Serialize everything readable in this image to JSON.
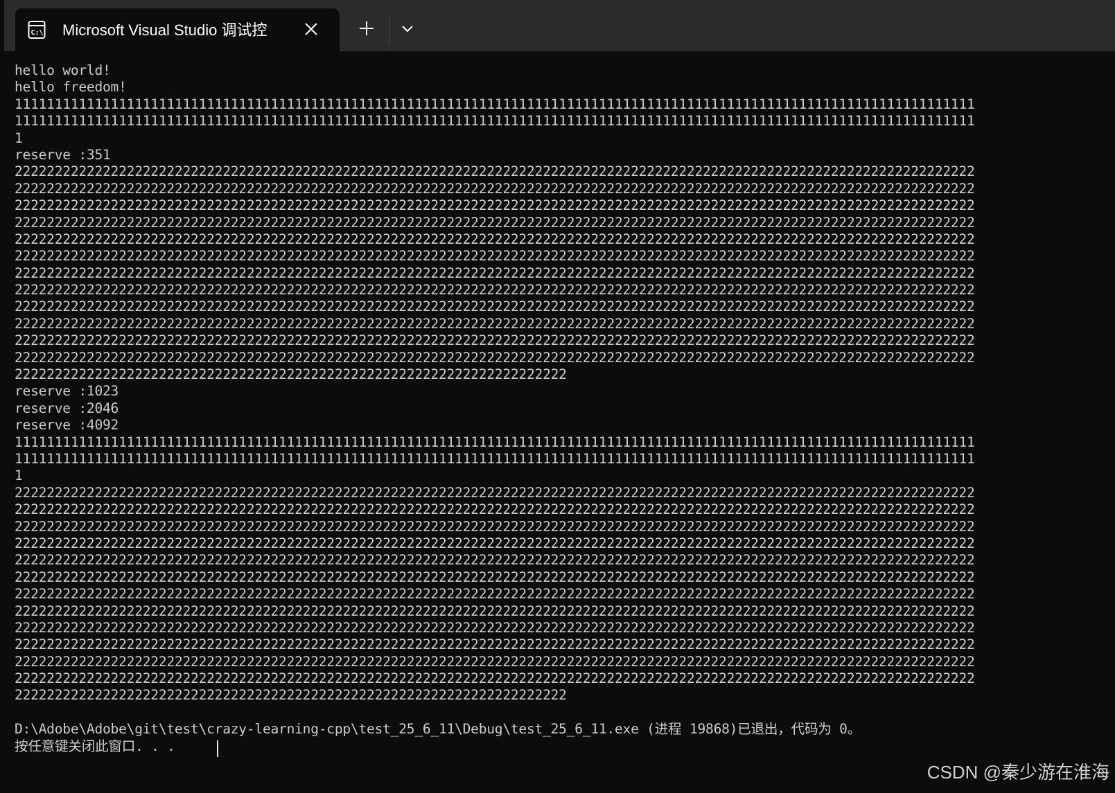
{
  "window": {
    "tab_title": "Microsoft Visual Studio 调试控",
    "icons": {
      "tab_icon": "console-icon",
      "close": "close-icon",
      "new_tab": "plus-icon",
      "dropdown": "chevron-down-icon"
    }
  },
  "terminal": {
    "lines": [
      "hello world!",
      "hello freedom!",
      "111111111111111111111111111111111111111111111111111111111111111111111111111111111111111111111111111111111111111111111111",
      "111111111111111111111111111111111111111111111111111111111111111111111111111111111111111111111111111111111111111111111111",
      "1",
      "reserve :351",
      "222222222222222222222222222222222222222222222222222222222222222222222222222222222222222222222222222222222222222222222222",
      "222222222222222222222222222222222222222222222222222222222222222222222222222222222222222222222222222222222222222222222222",
      "222222222222222222222222222222222222222222222222222222222222222222222222222222222222222222222222222222222222222222222222",
      "222222222222222222222222222222222222222222222222222222222222222222222222222222222222222222222222222222222222222222222222",
      "222222222222222222222222222222222222222222222222222222222222222222222222222222222222222222222222222222222222222222222222",
      "222222222222222222222222222222222222222222222222222222222222222222222222222222222222222222222222222222222222222222222222",
      "222222222222222222222222222222222222222222222222222222222222222222222222222222222222222222222222222222222222222222222222",
      "222222222222222222222222222222222222222222222222222222222222222222222222222222222222222222222222222222222222222222222222",
      "222222222222222222222222222222222222222222222222222222222222222222222222222222222222222222222222222222222222222222222222",
      "222222222222222222222222222222222222222222222222222222222222222222222222222222222222222222222222222222222222222222222222",
      "222222222222222222222222222222222222222222222222222222222222222222222222222222222222222222222222222222222222222222222222",
      "222222222222222222222222222222222222222222222222222222222222222222222222222222222222222222222222222222222222222222222222",
      "222222222222222222222222222222222222222222222222222222222222222222222",
      "reserve :1023",
      "reserve :2046",
      "reserve :4092",
      "111111111111111111111111111111111111111111111111111111111111111111111111111111111111111111111111111111111111111111111111",
      "111111111111111111111111111111111111111111111111111111111111111111111111111111111111111111111111111111111111111111111111",
      "1",
      "222222222222222222222222222222222222222222222222222222222222222222222222222222222222222222222222222222222222222222222222",
      "222222222222222222222222222222222222222222222222222222222222222222222222222222222222222222222222222222222222222222222222",
      "222222222222222222222222222222222222222222222222222222222222222222222222222222222222222222222222222222222222222222222222",
      "222222222222222222222222222222222222222222222222222222222222222222222222222222222222222222222222222222222222222222222222",
      "222222222222222222222222222222222222222222222222222222222222222222222222222222222222222222222222222222222222222222222222",
      "222222222222222222222222222222222222222222222222222222222222222222222222222222222222222222222222222222222222222222222222",
      "222222222222222222222222222222222222222222222222222222222222222222222222222222222222222222222222222222222222222222222222",
      "222222222222222222222222222222222222222222222222222222222222222222222222222222222222222222222222222222222222222222222222",
      "222222222222222222222222222222222222222222222222222222222222222222222222222222222222222222222222222222222222222222222222",
      "222222222222222222222222222222222222222222222222222222222222222222222222222222222222222222222222222222222222222222222222",
      "222222222222222222222222222222222222222222222222222222222222222222222222222222222222222222222222222222222222222222222222",
      "222222222222222222222222222222222222222222222222222222222222222222222222222222222222222222222222222222222222222222222222",
      "222222222222222222222222222222222222222222222222222222222222222222222",
      "",
      "D:\\Adobe\\Adobe\\git\\test\\crazy-learning-cpp\\test_25_6_11\\Debug\\test_25_6_11.exe (进程 19868)已退出，代码为 0。",
      "按任意键关闭此窗口. . ."
    ]
  },
  "watermark": "CSDN @秦少游在淮海"
}
